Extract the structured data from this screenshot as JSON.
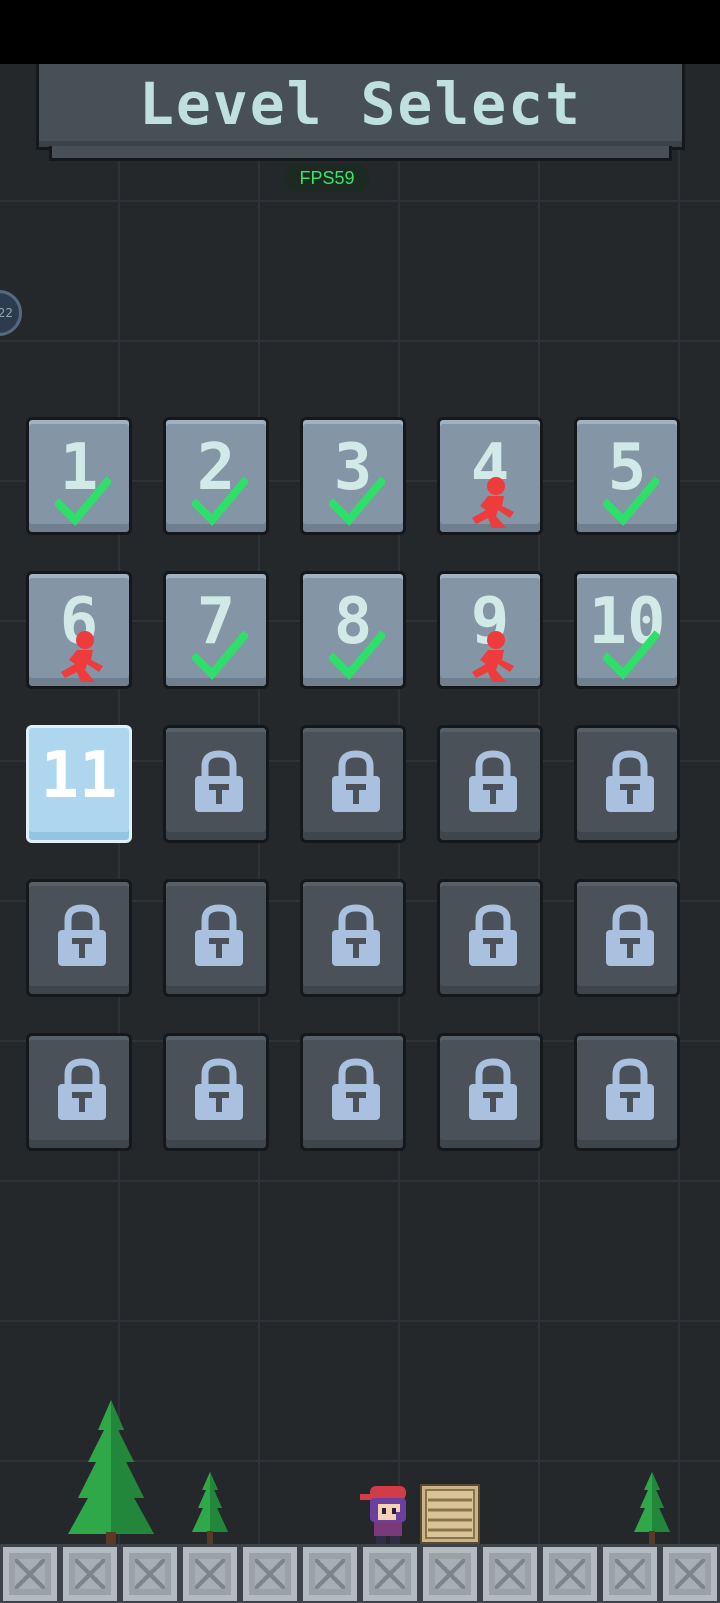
{
  "header": {
    "title": "Level Select"
  },
  "fps": {
    "label": "FPS59"
  },
  "side_bubble": {
    "text": "22"
  },
  "levels": [
    {
      "label": "1",
      "state": "completed",
      "badge": "check-icon"
    },
    {
      "label": "2",
      "state": "completed",
      "badge": "check-icon"
    },
    {
      "label": "3",
      "state": "completed",
      "badge": "check-icon"
    },
    {
      "label": "4",
      "state": "failed",
      "badge": "red-runner-icon"
    },
    {
      "label": "5",
      "state": "completed",
      "badge": "check-icon"
    },
    {
      "label": "6",
      "state": "failed",
      "badge": "red-runner-icon"
    },
    {
      "label": "7",
      "state": "completed",
      "badge": "check-icon"
    },
    {
      "label": "8",
      "state": "completed",
      "badge": "check-icon"
    },
    {
      "label": "9",
      "state": "failed",
      "badge": "red-runner-icon"
    },
    {
      "label": "10",
      "state": "completed",
      "badge": "check-icon"
    },
    {
      "label": "11",
      "state": "current",
      "badge": ""
    },
    {
      "label": "",
      "state": "locked",
      "badge": "lock-icon"
    },
    {
      "label": "",
      "state": "locked",
      "badge": "lock-icon"
    },
    {
      "label": "",
      "state": "locked",
      "badge": "lock-icon"
    },
    {
      "label": "",
      "state": "locked",
      "badge": "lock-icon"
    },
    {
      "label": "",
      "state": "locked",
      "badge": "lock-icon"
    },
    {
      "label": "",
      "state": "locked",
      "badge": "lock-icon"
    },
    {
      "label": "",
      "state": "locked",
      "badge": "lock-icon"
    },
    {
      "label": "",
      "state": "locked",
      "badge": "lock-icon"
    },
    {
      "label": "",
      "state": "locked",
      "badge": "lock-icon"
    },
    {
      "label": "",
      "state": "locked",
      "badge": "lock-icon"
    },
    {
      "label": "",
      "state": "locked",
      "badge": "lock-icon"
    },
    {
      "label": "",
      "state": "locked",
      "badge": "lock-icon"
    },
    {
      "label": "",
      "state": "locked",
      "badge": "lock-icon"
    },
    {
      "label": "",
      "state": "locked",
      "badge": "lock-icon"
    }
  ],
  "colors": {
    "check": "#2ee06a",
    "failed": "#ee3b3b",
    "lock": "#a9c1de",
    "tree": "#2fa84a"
  },
  "scene": {
    "items": [
      "pine-tree-icon",
      "small-pine-tree-icon",
      "player-character-icon",
      "wooden-crate-icon",
      "small-pine-tree-icon"
    ]
  }
}
